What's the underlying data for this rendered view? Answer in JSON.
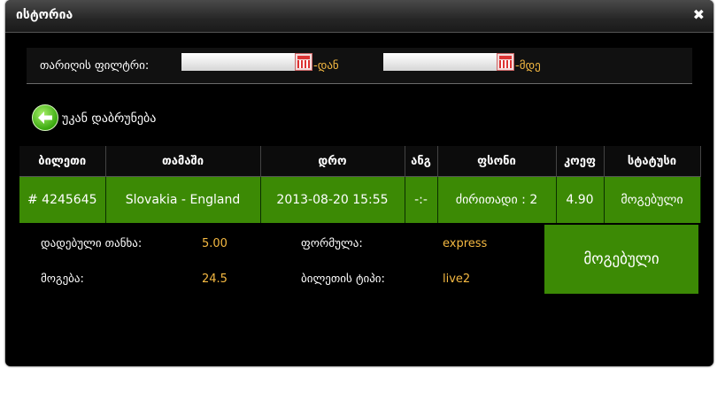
{
  "window": {
    "title": "ისტორია",
    "close_glyph": "✖"
  },
  "filter": {
    "label": "თარიღის ფილტრი:",
    "from_value": "",
    "from_suffix": "-დან",
    "to_value": "",
    "to_suffix": "-მდე"
  },
  "back": {
    "label": "უკან დაბრუნება"
  },
  "table": {
    "headers": [
      "ბილეთი",
      "თამაში",
      "დრო",
      "ანგ",
      "ფსონი",
      "კოეფ",
      "სტატუსი"
    ],
    "row": [
      "# 4245645",
      "Slovakia - England",
      "2013-08-20 15:55",
      "-:-",
      "ძირითადი : 2",
      "4.90",
      "მოგებული"
    ]
  },
  "details": {
    "stake_label": "დადებული თანხა:",
    "stake_value": "5.00",
    "win_label": "მოგება:",
    "win_value": "24.5",
    "formula_label": "ფორმულა:",
    "formula_value": "express",
    "ticket_type_label": "ბილეთის ტიპი:",
    "ticket_type_value": "live2"
  },
  "status_box": {
    "label": "მოგებული"
  },
  "colors": {
    "accent_green": "#3c8a05",
    "value_yellow": "#f5b942",
    "background": "#000000"
  }
}
